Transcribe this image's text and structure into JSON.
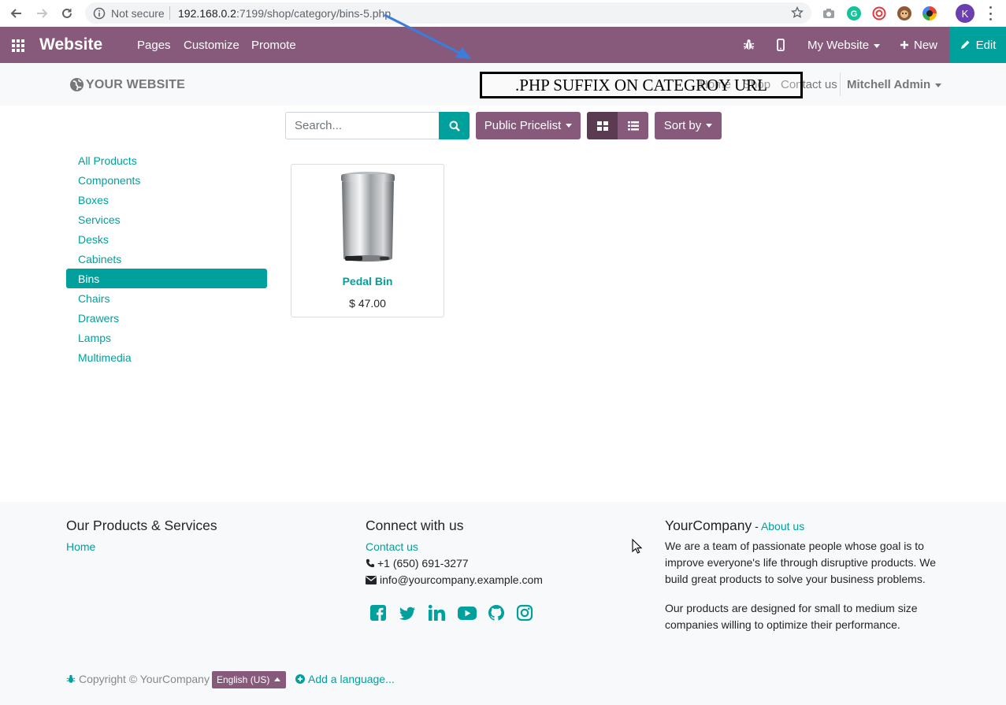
{
  "browser": {
    "security_label": "Not secure",
    "url_host": "192.168.0.2",
    "url_rest": ":7199/shop/category/bins-5.php",
    "profile_initial": "K"
  },
  "topbar": {
    "brand": "Website",
    "menu": [
      "Pages",
      "Customize",
      "Promote"
    ],
    "website_selector": "My Website",
    "new_label": "New",
    "edit_label": "Edit"
  },
  "site_header": {
    "logo_text": "YOUR WEBSITE",
    "menu": [
      "Home",
      "Shop",
      "Contact us"
    ],
    "user": "Mitchell Admin"
  },
  "annotation": {
    "text": ".PHP SUFFIX ON CATEGROY URL"
  },
  "shop": {
    "search_placeholder": "Search...",
    "pricelist_label": "Public Pricelist",
    "sort_label": "Sort by"
  },
  "categories": [
    {
      "label": "All Products",
      "active": false
    },
    {
      "label": "Components",
      "active": false
    },
    {
      "label": "Boxes",
      "active": false
    },
    {
      "label": "Services",
      "active": false
    },
    {
      "label": "Desks",
      "active": false
    },
    {
      "label": "Cabinets",
      "active": false
    },
    {
      "label": "Bins",
      "active": true
    },
    {
      "label": "Chairs",
      "active": false
    },
    {
      "label": "Drawers",
      "active": false
    },
    {
      "label": "Lamps",
      "active": false
    },
    {
      "label": "Multimedia",
      "active": false
    }
  ],
  "products": [
    {
      "name": "Pedal Bin",
      "price": "$ 47.00"
    }
  ],
  "footer": {
    "col1": {
      "title": "Our Products & Services",
      "links": [
        "Home"
      ]
    },
    "col2": {
      "title": "Connect with us",
      "contact_link": "Contact us",
      "phone": "+1 (650) 691-3277",
      "email": "info@yourcompany.example.com",
      "socials": [
        "facebook-icon",
        "twitter-icon",
        "linkedin-icon",
        "youtube-icon",
        "github-icon",
        "instagram-icon"
      ]
    },
    "col3": {
      "company": "YourCompany",
      "separator": " - ",
      "about_link": "About us",
      "para1": "We are a team of passionate people whose goal is to improve everyone's life through disruptive products. We build great products to solve your business problems.",
      "para2": "Our products are designed for small to medium size companies willing to optimize their performance."
    },
    "copyright": "Copyright © YourCompany",
    "language": "English (US)",
    "add_language": "Add a language..."
  },
  "colors": {
    "primary": "#875a7b",
    "secondary": "#00a09d"
  }
}
